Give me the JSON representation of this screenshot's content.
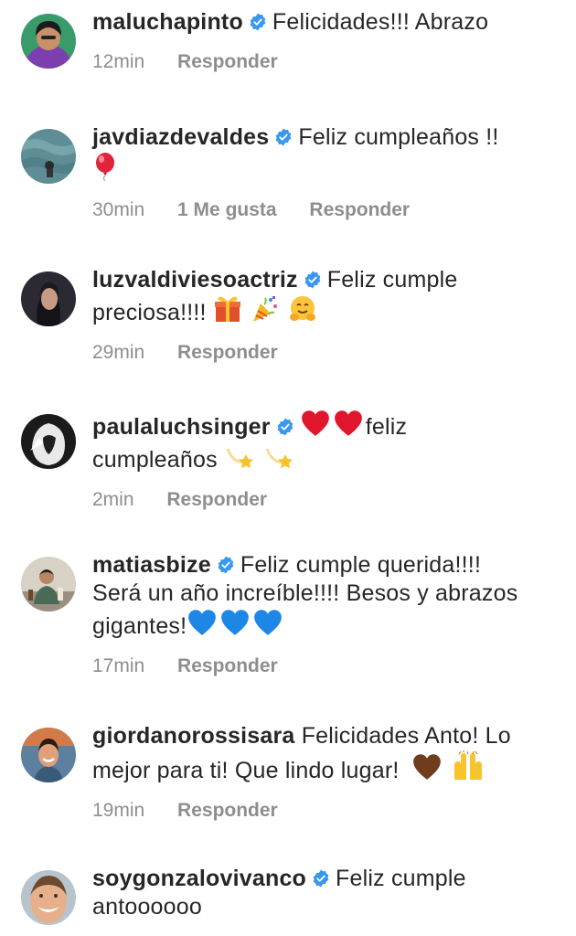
{
  "comments": [
    {
      "username": "maluchapinto",
      "verified": true,
      "text": "Felicidades!!! Abrazo",
      "time": "12min",
      "likes": "",
      "reply": "Responder"
    },
    {
      "username": "javdiazdevaldes",
      "verified": true,
      "text": "Feliz cumpleaños !!",
      "time": "30min",
      "likes": "1 Me gusta",
      "reply": "Responder"
    },
    {
      "username": "luzvaldiviesoactriz",
      "verified": true,
      "text": "Feliz cumple",
      "text2": "preciosa!!!!",
      "time": "29min",
      "likes": "",
      "reply": "Responder"
    },
    {
      "username": "paulaluchsinger",
      "verified": true,
      "text": "feliz",
      "text2": "cumpleaños",
      "time": "2min",
      "likes": "",
      "reply": "Responder"
    },
    {
      "username": "matiasbize",
      "verified": true,
      "text": "Feliz cumple querida!!!!",
      "text2": "Será un año increíble!!!! Besos y abrazos",
      "text3": "gigantes!",
      "time": "17min",
      "likes": "",
      "reply": "Responder"
    },
    {
      "username": "giordanorossisara",
      "verified": false,
      "text": "Felicidades Anto! Lo",
      "text2": "mejor para ti! Que lindo lugar!",
      "time": "19min",
      "likes": "",
      "reply": "Responder"
    },
    {
      "username": "soygonzalovivanco",
      "verified": true,
      "text": "Feliz cumple",
      "text2": "antoooooo",
      "time": "",
      "likes": "",
      "reply": ""
    }
  ],
  "icons": {
    "verified": "verified-badge-icon",
    "balloon": "balloon-emoji",
    "gift": "gift-emoji",
    "party": "party-popper-emoji",
    "hug": "hugging-face-emoji",
    "heart_red": "red-heart-emoji",
    "dizzy": "dizzy-star-emoji",
    "heart_blue": "blue-heart-emoji",
    "heart_brown": "brown-heart-emoji",
    "raised_hands": "raised-hands-emoji"
  },
  "colors": {
    "text": "#262626",
    "meta": "#8e8e8e",
    "verified": "#3897f0"
  }
}
